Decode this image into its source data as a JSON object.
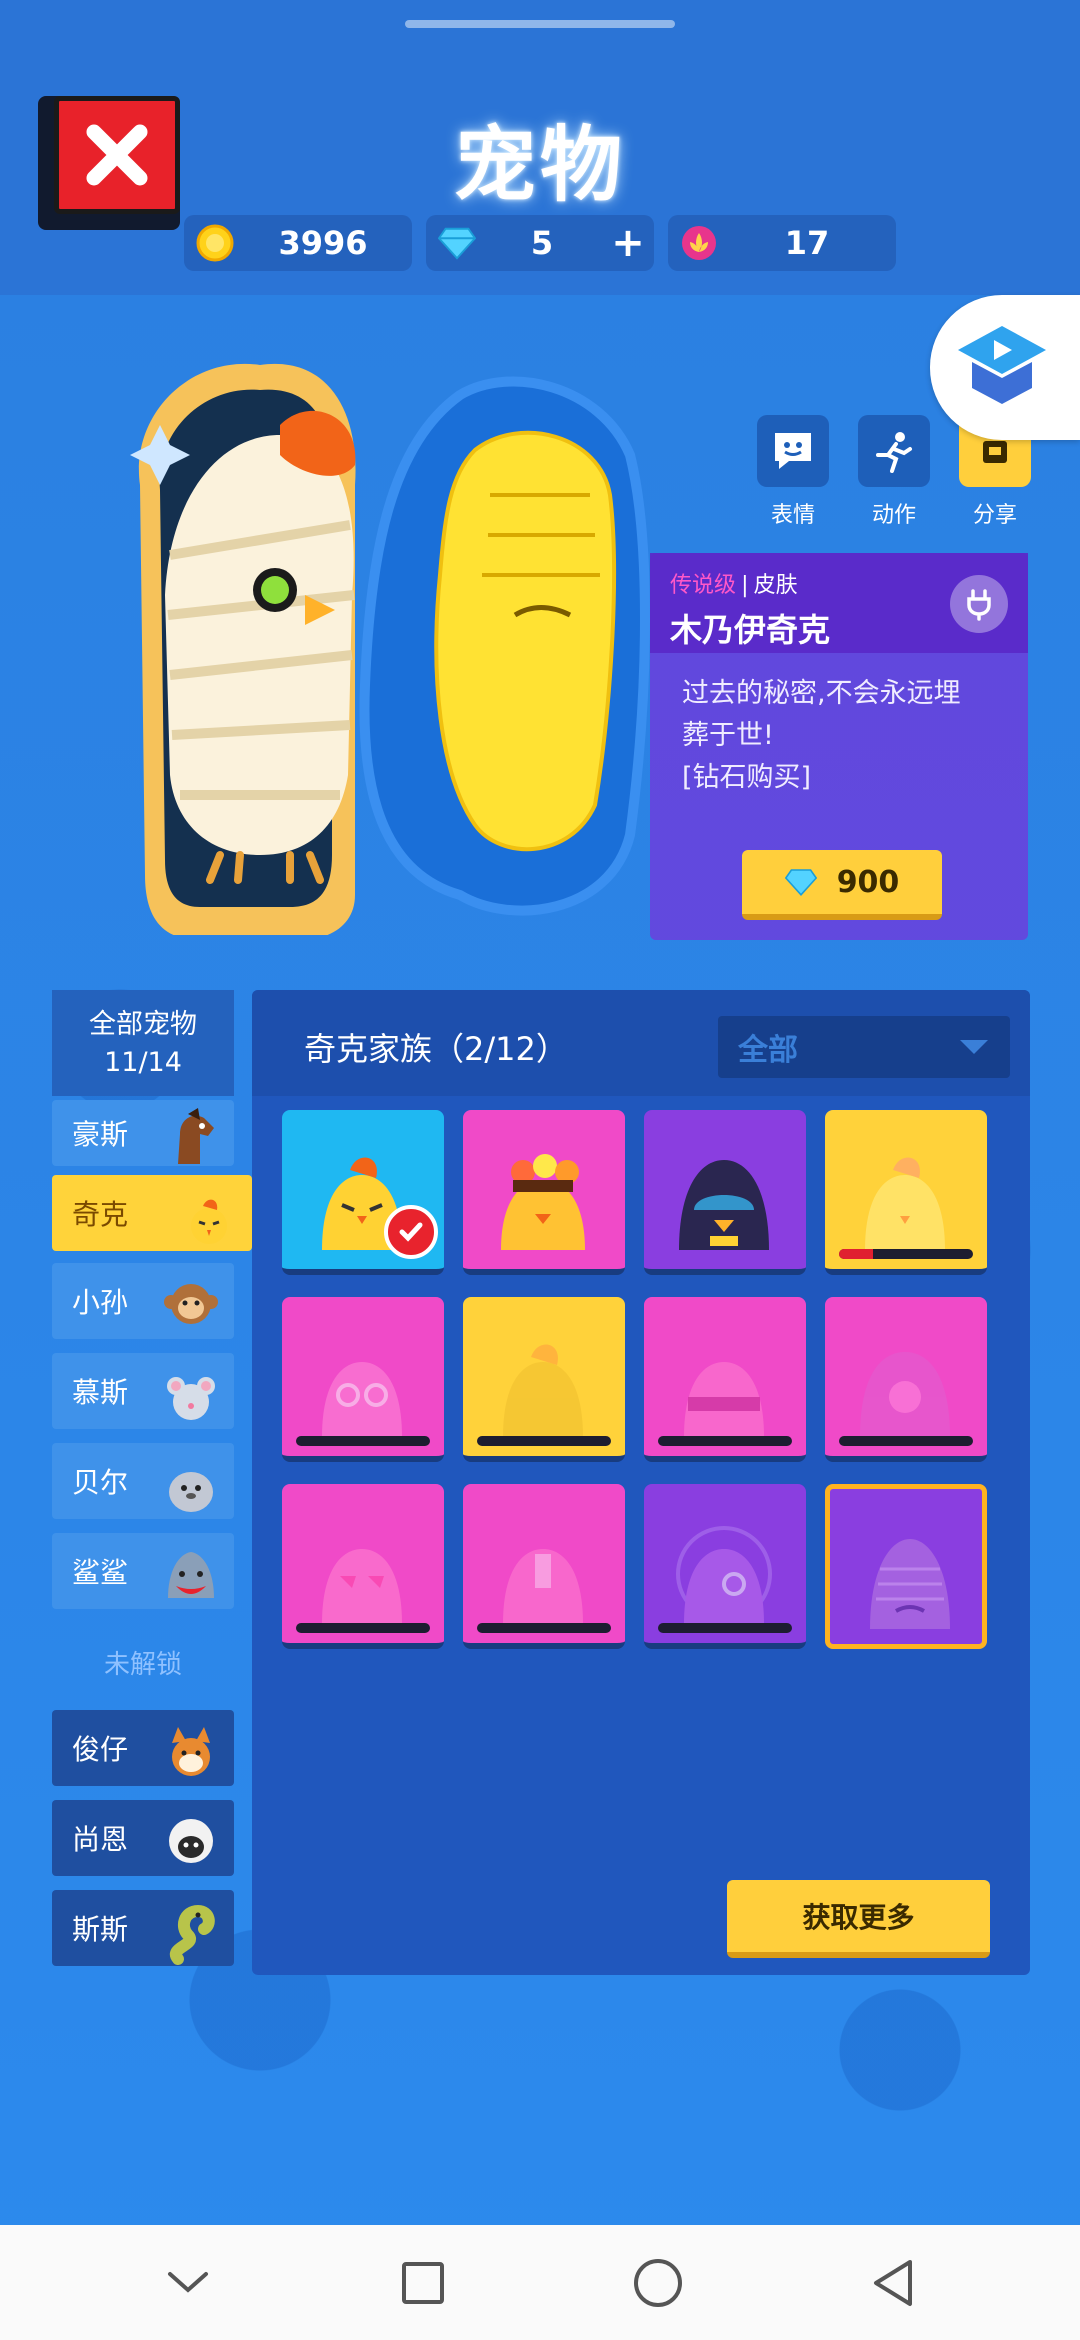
{
  "header": {
    "title": "宠物"
  },
  "currencies": [
    {
      "icon": "gold-coin-icon",
      "value": "3996"
    },
    {
      "icon": "diamond-icon",
      "value": "5",
      "plus": "+"
    },
    {
      "icon": "lotus-token-icon",
      "value": "17"
    }
  ],
  "actions": [
    {
      "icon": "emote-icon",
      "label": "表情"
    },
    {
      "icon": "run-icon",
      "label": "动作"
    },
    {
      "icon": "share-icon",
      "label": "分享"
    }
  ],
  "skin_card": {
    "tier": "传说级",
    "separator": "|",
    "type": "皮肤",
    "name": "木乃伊奇克",
    "description_line1": "过去的秘密,不会永远埋",
    "description_line2": "葬于世!",
    "description_line3": "[钻石购买]",
    "price": "900"
  },
  "sidebar": {
    "all_label": "全部宠物",
    "all_count": "11/14",
    "items": [
      {
        "label": "豪斯",
        "icon": "horse-pet-icon"
      },
      {
        "label": "奇克",
        "icon": "chick-pet-icon",
        "active": true
      },
      {
        "label": "小孙",
        "icon": "monkey-pet-icon"
      },
      {
        "label": "慕斯",
        "icon": "mouse-pet-icon"
      },
      {
        "label": "贝尔",
        "icon": "seal-pet-icon"
      },
      {
        "label": "鲨鲨",
        "icon": "shark-pet-icon"
      }
    ],
    "locked_label": "未解锁",
    "locked_items": [
      {
        "label": "俊仔",
        "icon": "shiba-pet-icon"
      },
      {
        "label": "尚恩",
        "icon": "sheep-pet-icon"
      },
      {
        "label": "斯斯",
        "icon": "snake-pet-icon"
      }
    ]
  },
  "panel": {
    "family": "奇克家族（2/12）",
    "filter": "全部",
    "get_more": "获取更多"
  },
  "colors": {
    "tile_cyan": "#1fb8f2",
    "tile_pink": "#f04ac8",
    "tile_purple": "#8a3ee0",
    "tile_yellow": "#ffd23a",
    "accent_yellow": "#ffcf3c"
  }
}
